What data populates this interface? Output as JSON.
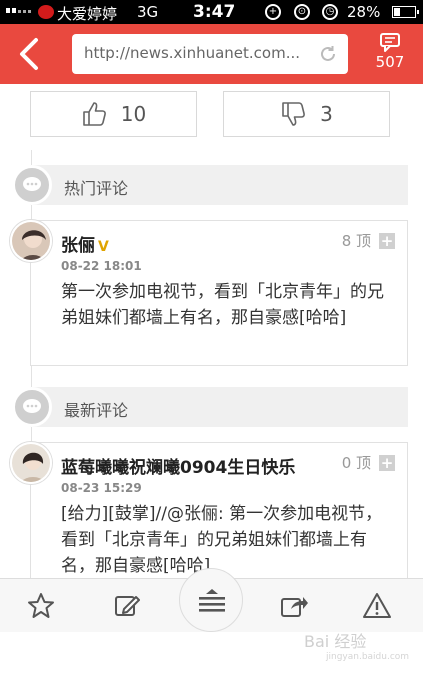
{
  "status_bar": {
    "carrier": "大爱婷婷",
    "network": "3G",
    "time": "3:47",
    "battery": "28%"
  },
  "nav": {
    "url": "http://news.xinhuanet.com...",
    "comment_count": "507"
  },
  "votes": {
    "up_count": "10",
    "down_count": "3"
  },
  "sections": {
    "hot": "热门评论",
    "latest": "最新评论"
  },
  "hot_comment": {
    "name": "张俪",
    "verified": "V",
    "date": "08-22 18:01",
    "text": "第一次参加电视节，看到「北京青年」的兄弟姐妹们都墙上有名，那自豪感[哈哈]",
    "ding": "8 顶",
    "plus": "+"
  },
  "latest_comment": {
    "name": "蓝莓曦曦祝斓曦0904生日快乐",
    "date": "08-23 15:29",
    "text": "[给力][鼓掌]//@张俪: 第一次参加电视节，看到「北京青年」的兄弟姐妹们都墙上有名，那自豪感[哈哈]",
    "ding": "0 顶",
    "plus": "+"
  },
  "watermark": {
    "brand": "Bai 经验",
    "sub": "jingyan.baidu.com"
  },
  "colors": {
    "nav_red": "#e9493f",
    "verified_gold": "#e0a400"
  },
  "icons": [
    "back-arrow-icon",
    "refresh-icon",
    "comment-icon",
    "thumbs-up-icon",
    "thumbs-down-icon",
    "chat-bubble-icon",
    "star-icon",
    "edit-icon",
    "menu-icon",
    "share-icon",
    "warning-icon"
  ]
}
